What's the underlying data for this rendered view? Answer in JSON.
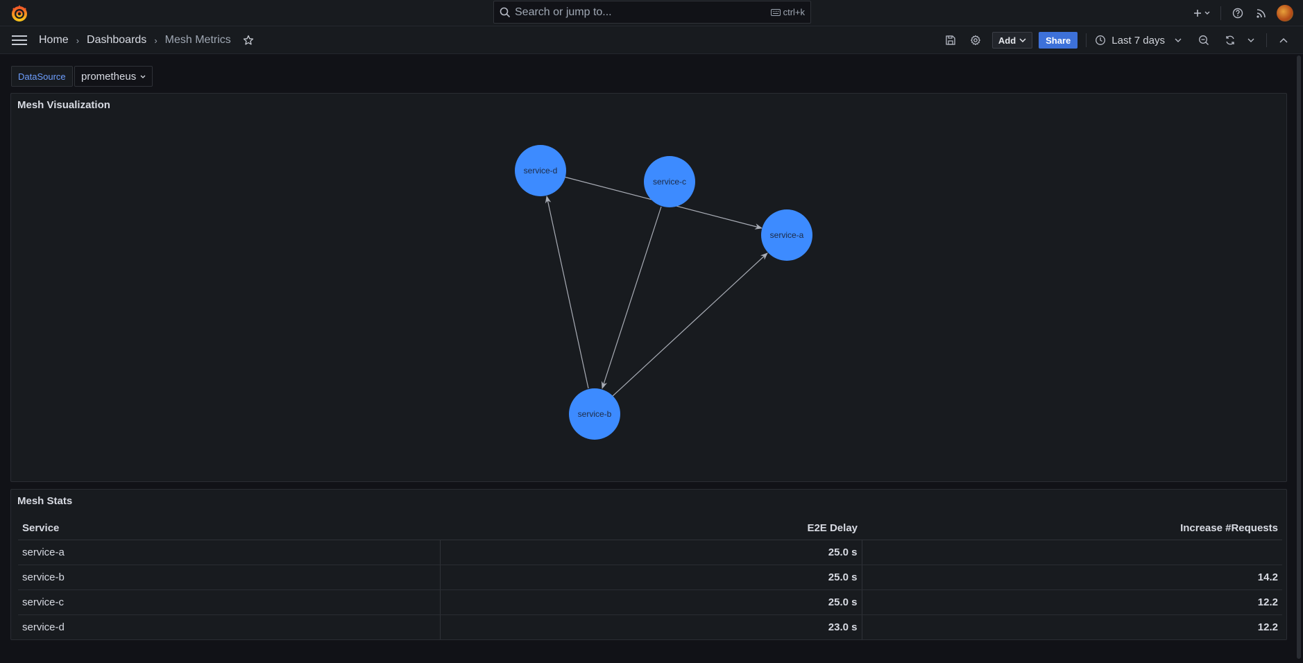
{
  "topbar": {
    "search_placeholder": "Search or jump to...",
    "search_shortcut": "ctrl+k"
  },
  "breadcrumbs": [
    "Home",
    "Dashboards",
    "Mesh Metrics"
  ],
  "toolbar": {
    "add_label": "Add",
    "share_label": "Share",
    "time_range": "Last 7 days"
  },
  "variables": {
    "label": "DataSource",
    "value": "prometheus"
  },
  "mesh_panel": {
    "title": "Mesh Visualization",
    "nodes": [
      "service-d",
      "service-c",
      "service-a",
      "service-b"
    ]
  },
  "stats_panel": {
    "title": "Mesh Stats",
    "columns": [
      "Service",
      "E2E Delay",
      "Increase #Requests"
    ],
    "rows": [
      [
        "service-a",
        "25.0 s",
        ""
      ],
      [
        "service-b",
        "25.0 s",
        "14.2"
      ],
      [
        "service-c",
        "25.0 s",
        "12.2"
      ],
      [
        "service-d",
        "23.0 s",
        "12.2"
      ]
    ]
  },
  "colors": {
    "node": "#3d8bff",
    "accent": "#3d71d9",
    "background": "#111217",
    "panel": "#181b1f"
  }
}
